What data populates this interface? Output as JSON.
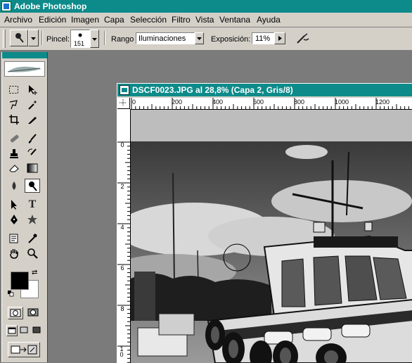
{
  "app": {
    "title": "Adobe Photoshop"
  },
  "menu": [
    "Archivo",
    "Edición",
    "Imagen",
    "Capa",
    "Selección",
    "Filtro",
    "Vista",
    "Ventana",
    "Ayuda"
  ],
  "options": {
    "brush_label": "Pincel:",
    "brush_size": "151",
    "range_label": "Rango",
    "range_value": "Iluminaciones",
    "exposure_label": "Exposición:",
    "exposure_value": "11%"
  },
  "document": {
    "title": "DSCF0023.JPG al 28,8% (Capa 2, Gris/8)",
    "hruler_labels": [
      "0",
      "200",
      "400",
      "600",
      "800",
      "1000",
      "1200"
    ],
    "vruler_labels": [
      "0",
      "2",
      "4",
      "6",
      "8",
      "10"
    ]
  },
  "tools": [
    "marquee-tool",
    "move-tool",
    "lasso-tool",
    "magic-wand-tool",
    "crop-tool",
    "slice-tool",
    "healing-brush-tool",
    "brush-tool",
    "clone-stamp-tool",
    "history-brush-tool",
    "eraser-tool",
    "gradient-tool",
    "smudge-tool",
    "burn-tool",
    "path-selection-tool",
    "type-tool",
    "pen-tool",
    "shape-tool",
    "notes-tool",
    "eyedropper-tool",
    "hand-tool",
    "zoom-tool"
  ],
  "colors": {
    "accent": "#0d8a8a",
    "chrome": "#d4d0c8",
    "workspace": "#7b7b7b"
  }
}
